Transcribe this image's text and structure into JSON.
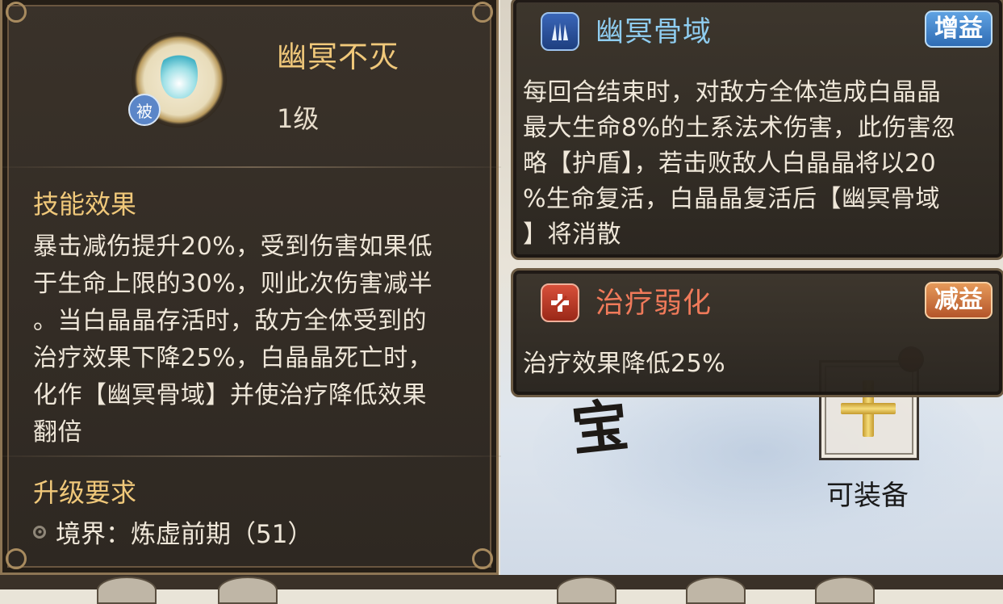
{
  "skill": {
    "name": "幽冥不灭",
    "level": "1级",
    "badge": "被",
    "effect_title": "技能效果",
    "effect_lines": [
      "暴击减伤提升20%，受到伤害如果低",
      "于生命上限的30%，则此次伤害减半",
      "。当白晶晶存活时，敌方全体受到的",
      "治疗效果下降25%，白晶晶死亡时，",
      "化作【幽冥骨域】并使治疗降低效果",
      "翻倍"
    ],
    "upgrade_title": "升级要求",
    "upgrade_requirement": "境界：炼虚前期（51）"
  },
  "buffs": [
    {
      "title": "幽冥骨域",
      "tag": "增益",
      "title_color": "#8fcdf0",
      "tag_color": "#3b7ec4",
      "icon": "claw-icon",
      "lines": [
        "每回合结束时，对敌方全体造成白晶晶",
        "最大生命8%的土系法术伤害，此伤害忽",
        "略【护盾】，若击败敌人白晶晶将以20",
        "%生命复活，白晶晶复活后【幽冥骨域",
        "】将消散"
      ]
    },
    {
      "title": "治疗弱化",
      "tag": "减益",
      "title_color": "#f07a5a",
      "tag_color": "#c8672e",
      "icon": "broken-cross-icon",
      "lines": [
        "治疗效果降低25%"
      ]
    }
  ],
  "equip": {
    "label": "可装备",
    "calligraphy": "宝"
  }
}
